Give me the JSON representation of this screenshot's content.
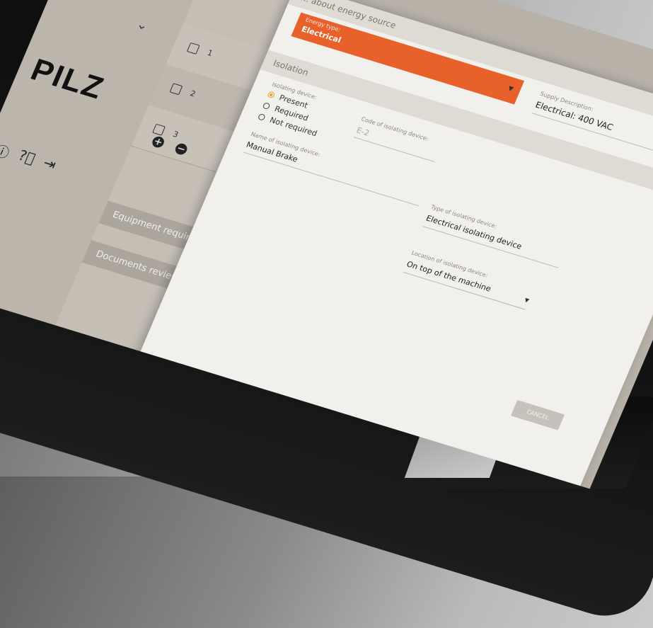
{
  "brand": {
    "logo_text": "PILZ"
  },
  "sidebar": {
    "items": [
      {
        "number": "1"
      },
      {
        "number": "2"
      },
      {
        "number": "3"
      }
    ],
    "add_symbol": "+",
    "remove_symbol": "−",
    "bottom_icons": [
      "info-icon",
      "help-icon",
      "logout-icon"
    ]
  },
  "sections": {
    "equipment_required": "Equipment required",
    "documents_reviewed": "Documents reviewed"
  },
  "dialog": {
    "energy_section_title": "... about energy source",
    "energy_type_label": "Energy type:",
    "energy_type_value": "Electrical",
    "supply_description_label": "Supply Description:",
    "supply_description_value": "Electrical: 400 VAC",
    "isolation_title": "Isolation",
    "isolating_device_label": "Isolating device:",
    "isolating_device_options": [
      "Present",
      "Required",
      "Not required"
    ],
    "selected_option": "Present",
    "code_label": "Code of isolating device:",
    "code_value": "E-2",
    "name_label": "Name of isolating device:",
    "name_value": "Manual Brake",
    "type_label": "Type of isolating device:",
    "type_value": "Electrical isolating device",
    "location_label": "Location of isolating device:",
    "location_value": "On top of the machine",
    "cancel_label": "CANCEL"
  },
  "colors": {
    "accent": "#e8602a",
    "radio_selected": "#e3a72a"
  }
}
